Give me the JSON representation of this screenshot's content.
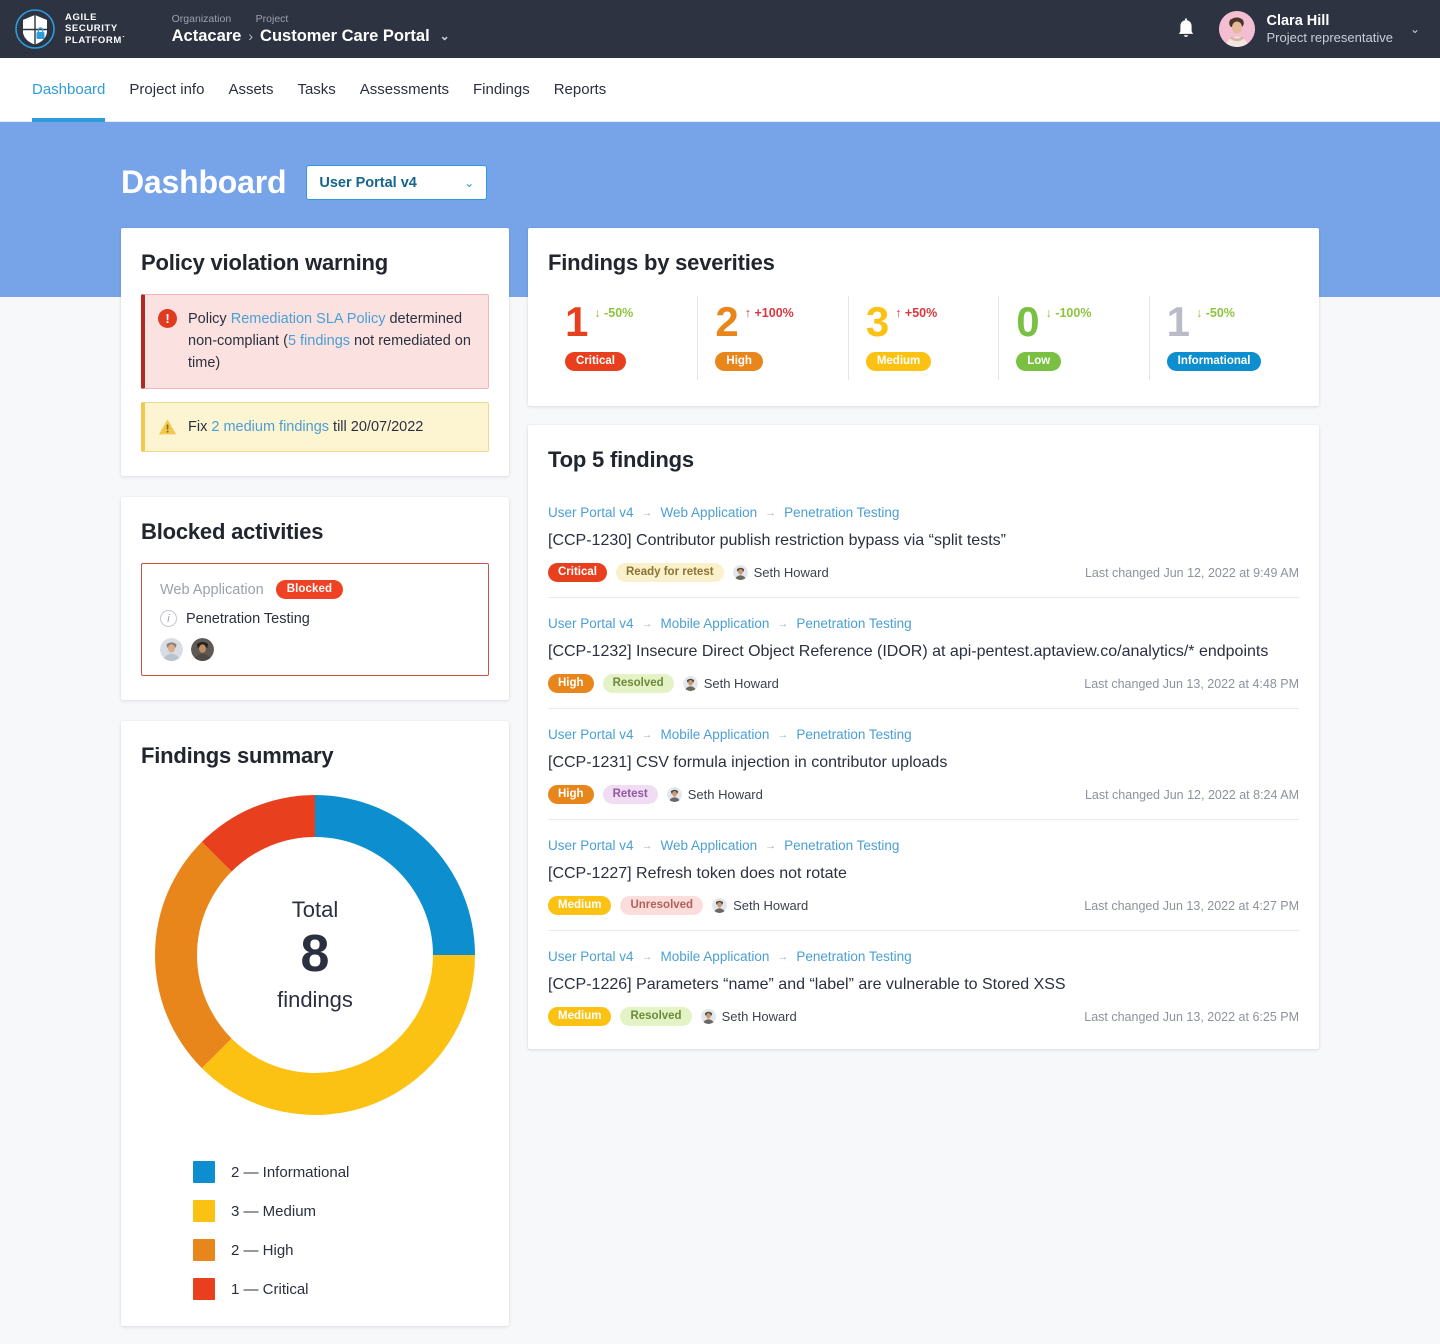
{
  "brand": {
    "name_lines": [
      "AGILE",
      "SECURITY",
      "PLATFORM˙"
    ],
    "shield_icon": "shield-lock-icon"
  },
  "topbar": {
    "org_label": "Organization",
    "project_label": "Project",
    "org_value": "Actacare",
    "separator": "›",
    "project_value": "Customer Care Portal",
    "project_caret": "⌄",
    "bell_icon": "bell-icon",
    "user": {
      "name": "Clara Hill",
      "role": "Project representative",
      "caret": "⌄"
    }
  },
  "nav": {
    "items": [
      {
        "label": "Dashboard",
        "active": true
      },
      {
        "label": "Project info",
        "active": false
      },
      {
        "label": "Assets",
        "active": false
      },
      {
        "label": "Tasks",
        "active": false
      },
      {
        "label": "Assessments",
        "active": false
      },
      {
        "label": "Findings",
        "active": false
      },
      {
        "label": "Reports",
        "active": false
      }
    ]
  },
  "banner": {
    "title": "Dashboard",
    "portal_select": {
      "value": "User Portal v4",
      "caret": "⌄"
    },
    "bg_color": "#77a4e8"
  },
  "policy_card": {
    "title": "Policy violation warning",
    "error": {
      "icon": "error-exclamation-icon",
      "prefix": "Policy ",
      "link": "Remediation SLA Policy",
      "mid": " determined non-compliant (",
      "link2": "5 findings",
      "suffix": " not remediated on time)"
    },
    "warning": {
      "icon": "warning-triangle-icon",
      "prefix": "Fix ",
      "link": "2 medium findings",
      "suffix": " till 20/07/2022"
    }
  },
  "blocked_card": {
    "title": "Blocked activities",
    "app": "Web Application",
    "status_badge": "Blocked",
    "info_icon": "info-icon",
    "task": "Penetration Testing",
    "avatars": [
      "avatar-person-1",
      "avatar-person-2"
    ]
  },
  "findings_summary": {
    "title": "Findings summary",
    "center_top": "Total",
    "center_number": "8",
    "center_bottom": "findings"
  },
  "chart_data": {
    "type": "pie",
    "title": "Findings summary",
    "subtitle": "Total 8 findings",
    "total": 8,
    "categories": [
      "Informational",
      "Medium",
      "High",
      "Critical"
    ],
    "values": [
      2,
      3,
      2,
      1
    ],
    "colors": [
      "#0d8ecf",
      "#fbc213",
      "#e8861c",
      "#e8401f"
    ],
    "legend": [
      {
        "text": "2 — Informational",
        "count": 2,
        "label": "Informational",
        "color": "#0d8ecf"
      },
      {
        "text": "3 — Medium",
        "count": 3,
        "label": "Medium",
        "color": "#fbc213"
      },
      {
        "text": "2 — High",
        "count": 2,
        "label": "High",
        "color": "#e8861c"
      },
      {
        "text": "1 — Critical",
        "count": 1,
        "label": "Critical",
        "color": "#e8401f"
      }
    ],
    "legend_position": "bottom",
    "grid": false
  },
  "severities": {
    "title": "Findings by severities",
    "items": [
      {
        "count": "1",
        "delta": "-50%",
        "arrow": "↓",
        "delta_color": "#8bc53f",
        "label": "Critical",
        "num_color": "#e8401f",
        "pill_bg": "#e8401f"
      },
      {
        "count": "2",
        "delta": "+100%",
        "arrow": "↑",
        "delta_color": "#d9363e",
        "label": "High",
        "num_color": "#e8861c",
        "pill_bg": "#e8861c"
      },
      {
        "count": "3",
        "delta": "+50%",
        "arrow": "↑",
        "delta_color": "#d9363e",
        "label": "Medium",
        "num_color": "#fbc213",
        "pill_bg": "#fbc213"
      },
      {
        "count": "0",
        "delta": "-100%",
        "arrow": "↓",
        "delta_color": "#8bc53f",
        "label": "Low",
        "num_color": "#7ac143",
        "pill_bg": "#7ac143"
      },
      {
        "count": "1",
        "delta": "-50%",
        "arrow": "↓",
        "delta_color": "#8bc53f",
        "label": "Informational",
        "num_color": "#b9bcc6",
        "pill_bg": "#0d8ecf"
      }
    ]
  },
  "top_findings": {
    "title": "Top 5 findings",
    "changed_prefix": "Last changed ",
    "items": [
      {
        "crumbs": [
          "User Portal v4",
          "Web Application",
          "Penetration Testing"
        ],
        "title": "[CCP-1230] Contributor publish restriction bypass via “split tests”",
        "severity": "Critical",
        "sev_bg": "#e8401f",
        "sev_fg": "#ffffff",
        "status": "Ready for retest",
        "st_bg": "#fbf0cc",
        "st_fg": "#8a7430",
        "assignee": "Seth Howard",
        "changed": "Last changed Jun 12, 2022 at 9:49 AM"
      },
      {
        "crumbs": [
          "User Portal v4",
          "Mobile Application",
          "Penetration Testing"
        ],
        "title": "[CCP-1232] Insecure Direct Object Reference (IDOR) at api-pentest.aptaview.co/analytics/* endpoints",
        "severity": "High",
        "sev_bg": "#e8861c",
        "sev_fg": "#ffffff",
        "status": "Resolved",
        "st_bg": "#e4f3c6",
        "st_fg": "#6d8a3a",
        "assignee": "Seth Howard",
        "changed": "Last changed Jun 13, 2022 at 4:48 PM"
      },
      {
        "crumbs": [
          "User Portal v4",
          "Mobile Application",
          "Penetration Testing"
        ],
        "title": "[CCP-1231] CSV formula injection in contributor uploads",
        "severity": "High",
        "sev_bg": "#e8861c",
        "sev_fg": "#ffffff",
        "status": "Retest",
        "st_bg": "#f0dcf3",
        "st_fg": "#8e5aa0",
        "assignee": "Seth Howard",
        "changed": "Last changed Jun 12, 2022 at 8:24 AM"
      },
      {
        "crumbs": [
          "User Portal v4",
          "Web Application",
          "Penetration Testing"
        ],
        "title": "[CCP-1227] Refresh token does not rotate",
        "severity": "Medium",
        "sev_bg": "#fbc213",
        "sev_fg": "#ffffff",
        "status": "Unresolved",
        "st_bg": "#fbdedb",
        "st_fg": "#b4605a",
        "assignee": "Seth Howard",
        "changed": "Last changed Jun 13, 2022 at 4:27 PM"
      },
      {
        "crumbs": [
          "User Portal v4",
          "Mobile Application",
          "Penetration Testing"
        ],
        "title": "[CCP-1226] Parameters “name” and “label” are vulnerable to Stored XSS",
        "severity": "Medium",
        "sev_bg": "#fbc213",
        "sev_fg": "#ffffff",
        "status": "Resolved",
        "st_bg": "#e4f3c6",
        "st_fg": "#6d8a3a",
        "assignee": "Seth Howard",
        "changed": "Last changed Jun 13, 2022 at 6:25 PM"
      }
    ]
  }
}
